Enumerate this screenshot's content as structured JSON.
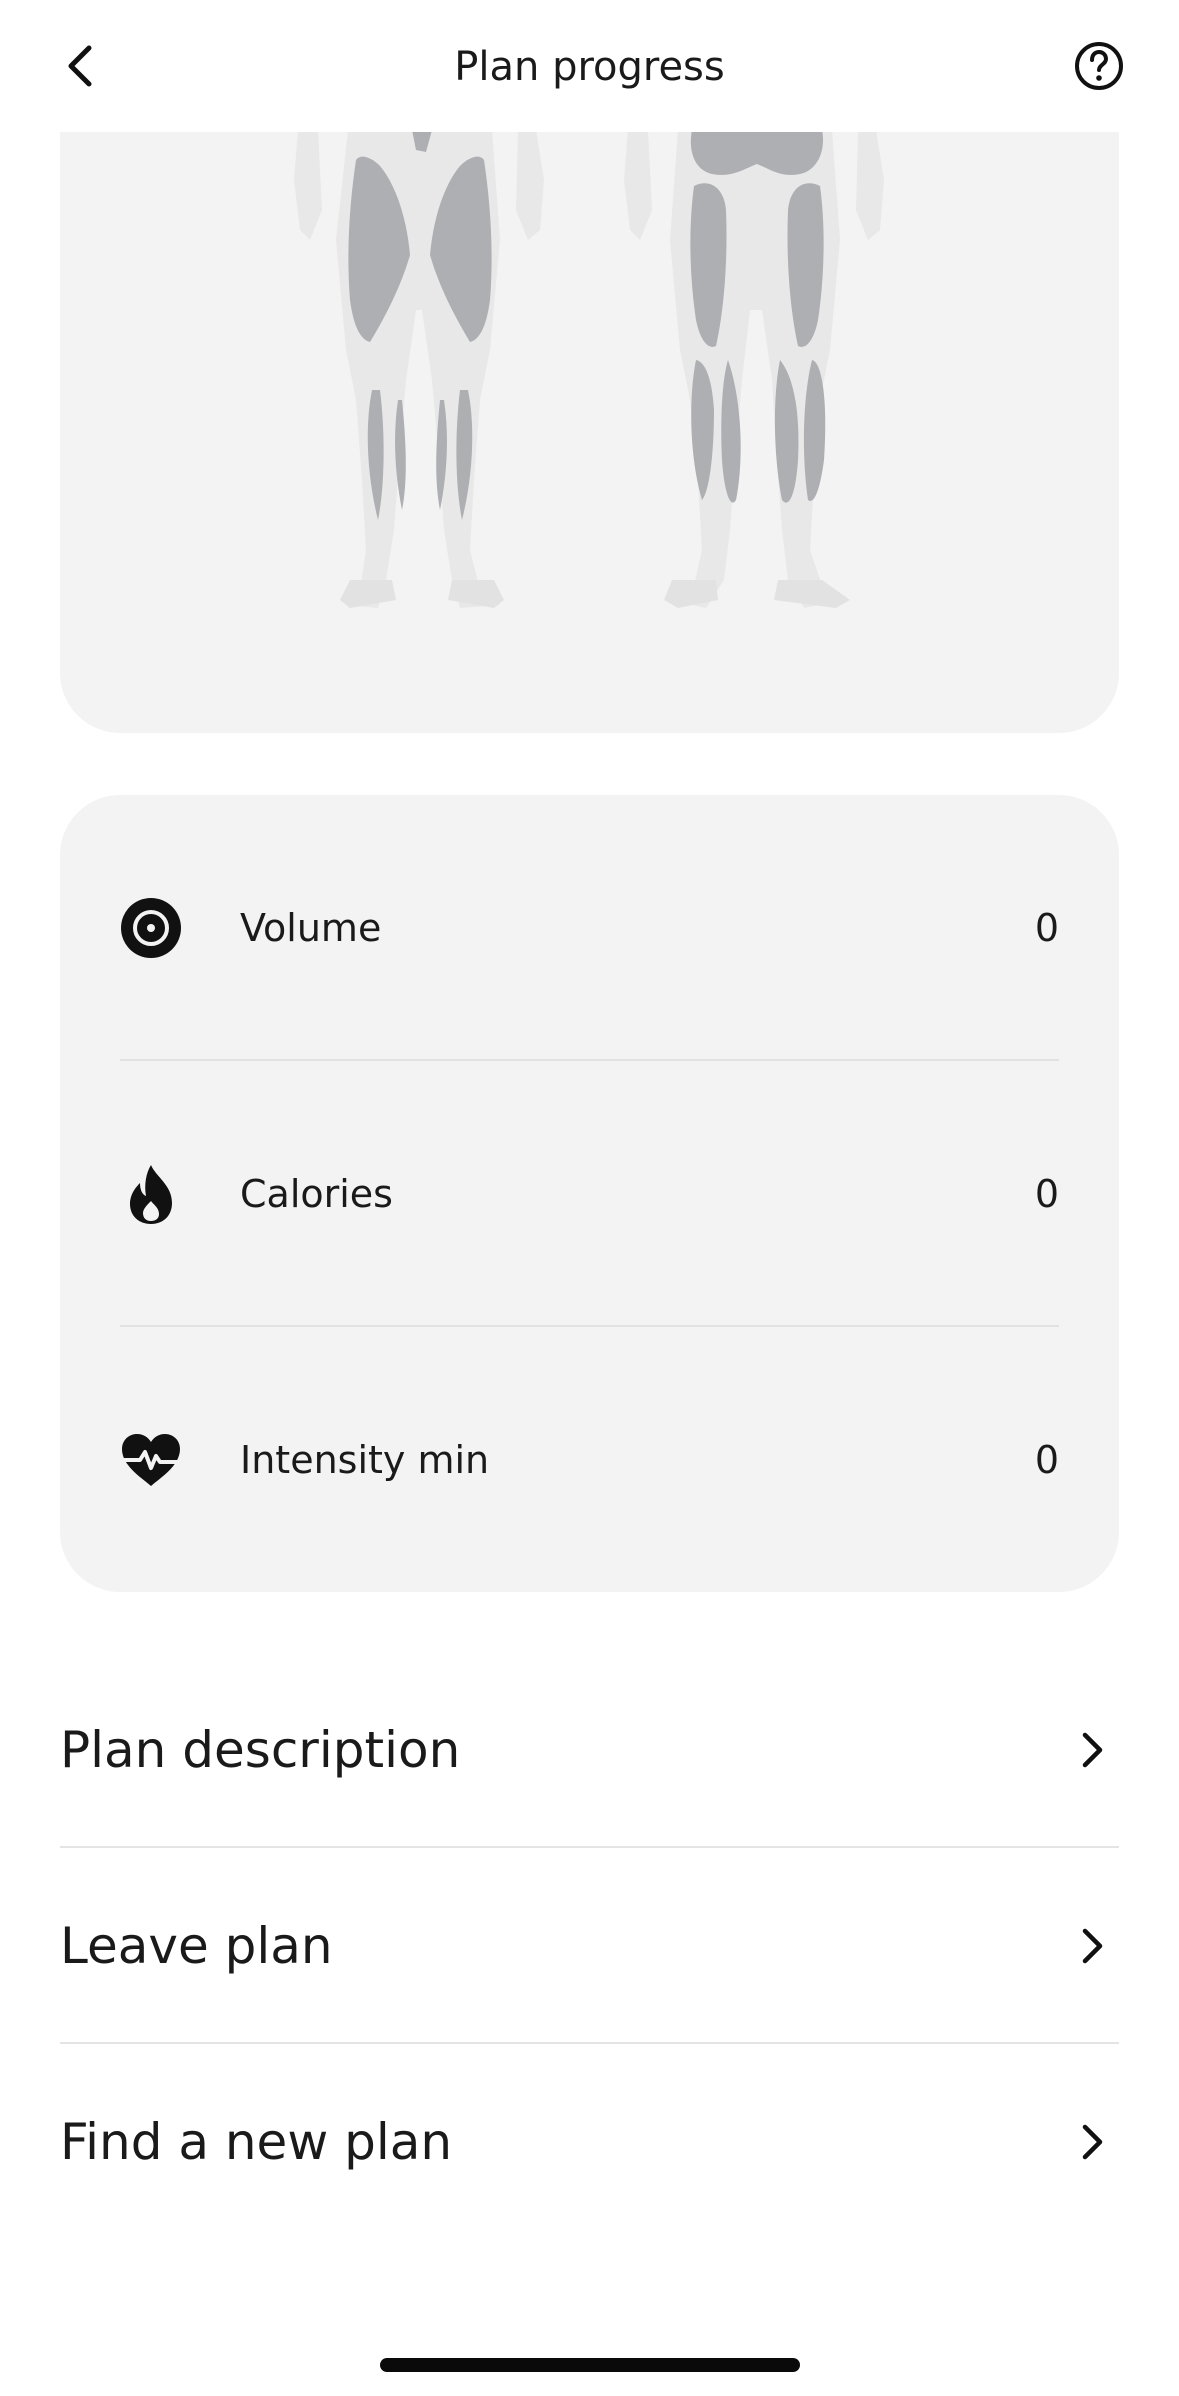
{
  "header": {
    "title": "Plan progress",
    "back_icon": "chevron-left-icon",
    "help_icon": "question-circle-icon"
  },
  "body_map": {
    "colors": {
      "card": "#f3f3f3",
      "body": "#e8e8e8",
      "muscle": "#aeafb3"
    }
  },
  "stats": {
    "items": [
      {
        "label": "Volume",
        "value": "0",
        "icon": "volume-target-icon"
      },
      {
        "label": "Calories",
        "value": "0",
        "icon": "flame-icon"
      },
      {
        "label": "Intensity min",
        "value": "0",
        "icon": "heart-pulse-icon"
      }
    ]
  },
  "menu": {
    "items": [
      {
        "label": "Plan description",
        "icon": "chevron-right-icon"
      },
      {
        "label": "Leave plan",
        "icon": "chevron-right-icon"
      },
      {
        "label": "Find a new plan",
        "icon": "chevron-right-icon"
      }
    ]
  }
}
